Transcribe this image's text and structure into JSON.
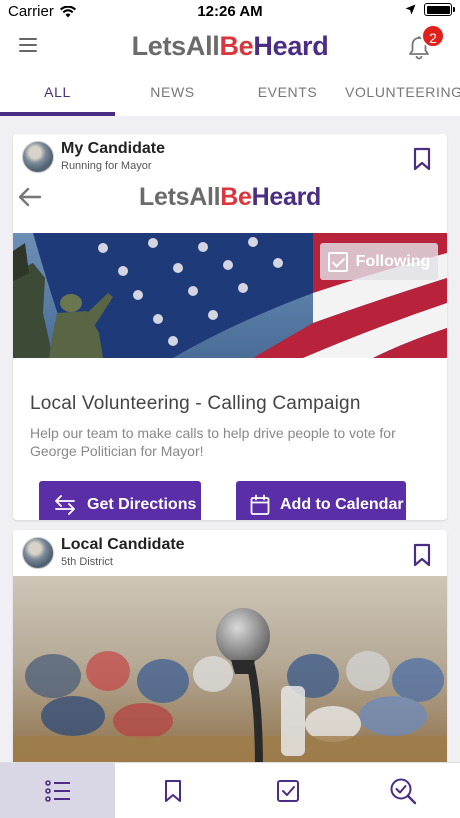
{
  "status_bar": {
    "carrier": "Carrier",
    "time": "12:26 AM"
  },
  "header": {
    "logo": {
      "part1": "LetsAll",
      "part2": "Be",
      "part3": "Heard"
    },
    "notification_count": "2"
  },
  "tabs": [
    {
      "label": "ALL",
      "active": true
    },
    {
      "label": "NEWS",
      "active": false
    },
    {
      "label": "EVENTS",
      "active": false
    },
    {
      "label": "VOLUNTEERING",
      "active": false
    }
  ],
  "cards": [
    {
      "candidate_name": "My Candidate",
      "candidate_subtitle": "Running for Mayor",
      "mini_logo": {
        "part1": "LetsAll",
        "part2": "Be",
        "part3": "Heard"
      },
      "following_label": "Following",
      "title": "Local Volunteering - Calling Campaign",
      "description": "Help our team to make calls to help drive people to vote for George Politician for Mayor!",
      "actions": {
        "directions": "Get Directions",
        "calendar": "Add to Calendar"
      }
    },
    {
      "candidate_name": "Local Candidate",
      "candidate_subtitle": "5th District"
    }
  ],
  "bottom_nav": [
    {
      "icon": "list-icon",
      "active": true
    },
    {
      "icon": "bookmark-icon",
      "active": false
    },
    {
      "icon": "checkbox-icon",
      "active": false
    },
    {
      "icon": "search-check-icon",
      "active": false
    }
  ],
  "colors": {
    "brand_purple": "#4b2e83",
    "button_purple": "#5a2ea6",
    "logo_red": "#d9363e",
    "logo_gray": "#6b6b6b",
    "badge_red": "#e0201b"
  }
}
